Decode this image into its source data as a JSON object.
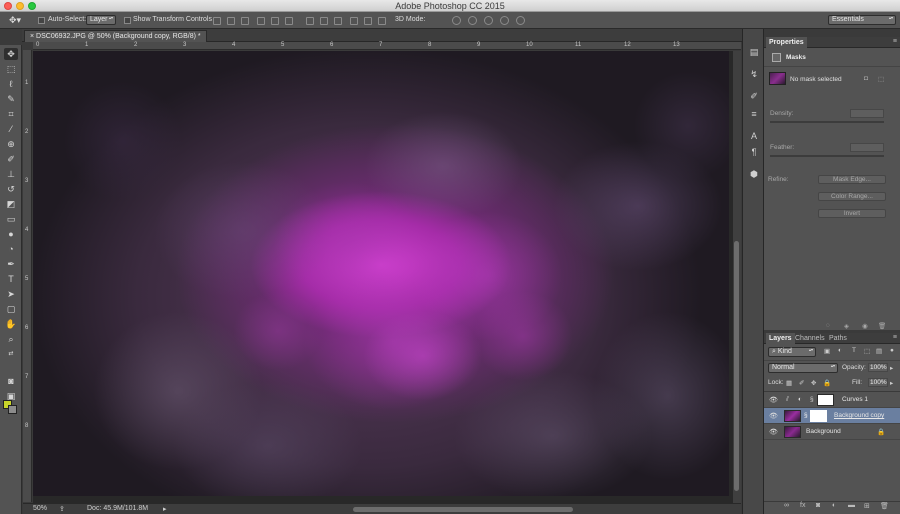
{
  "window": {
    "title": "Adobe Photoshop CC 2015"
  },
  "options_bar": {
    "auto_select_label": "Auto-Select:",
    "auto_select_value": "Layer",
    "transform_controls_label": "Show Transform Controls",
    "mode3d_label": "3D Mode:",
    "workspace": "Essentials"
  },
  "document": {
    "tab_label": "DSC06932.JPG @ 50% (Background copy, RGB/8) *",
    "ruler_top": [
      "0",
      "1",
      "2",
      "3",
      "4",
      "5",
      "6",
      "7",
      "8",
      "9",
      "10",
      "11",
      "12",
      "13"
    ],
    "ruler_left": [
      "1",
      "2",
      "3",
      "4",
      "5",
      "6",
      "7",
      "8"
    ],
    "zoom": "50%",
    "doc_size": "Doc: 45.9M/101.8M"
  },
  "colors": {
    "foreground": "#c8d42a",
    "background": "#8c8c8c",
    "selected_layer": "#6a7fa0"
  },
  "properties": {
    "tab": "Properties",
    "section": "Masks",
    "mask_status": "No mask selected",
    "density_label": "Density:",
    "feather_label": "Feather:",
    "refine_label": "Refine:",
    "btn_mask_edge": "Mask Edge...",
    "btn_color_range": "Color Range...",
    "btn_invert": "Invert"
  },
  "layers": {
    "tabs": [
      "Layers",
      "Channels",
      "Paths"
    ],
    "filter": "Kind",
    "blend_mode": "Normal",
    "opacity_label": "Opacity:",
    "opacity": "100%",
    "lock_label": "Lock:",
    "fill_label": "Fill:",
    "fill": "100%",
    "items": [
      {
        "name": "Curves 1"
      },
      {
        "name": "Background copy"
      },
      {
        "name": "Background"
      }
    ]
  }
}
